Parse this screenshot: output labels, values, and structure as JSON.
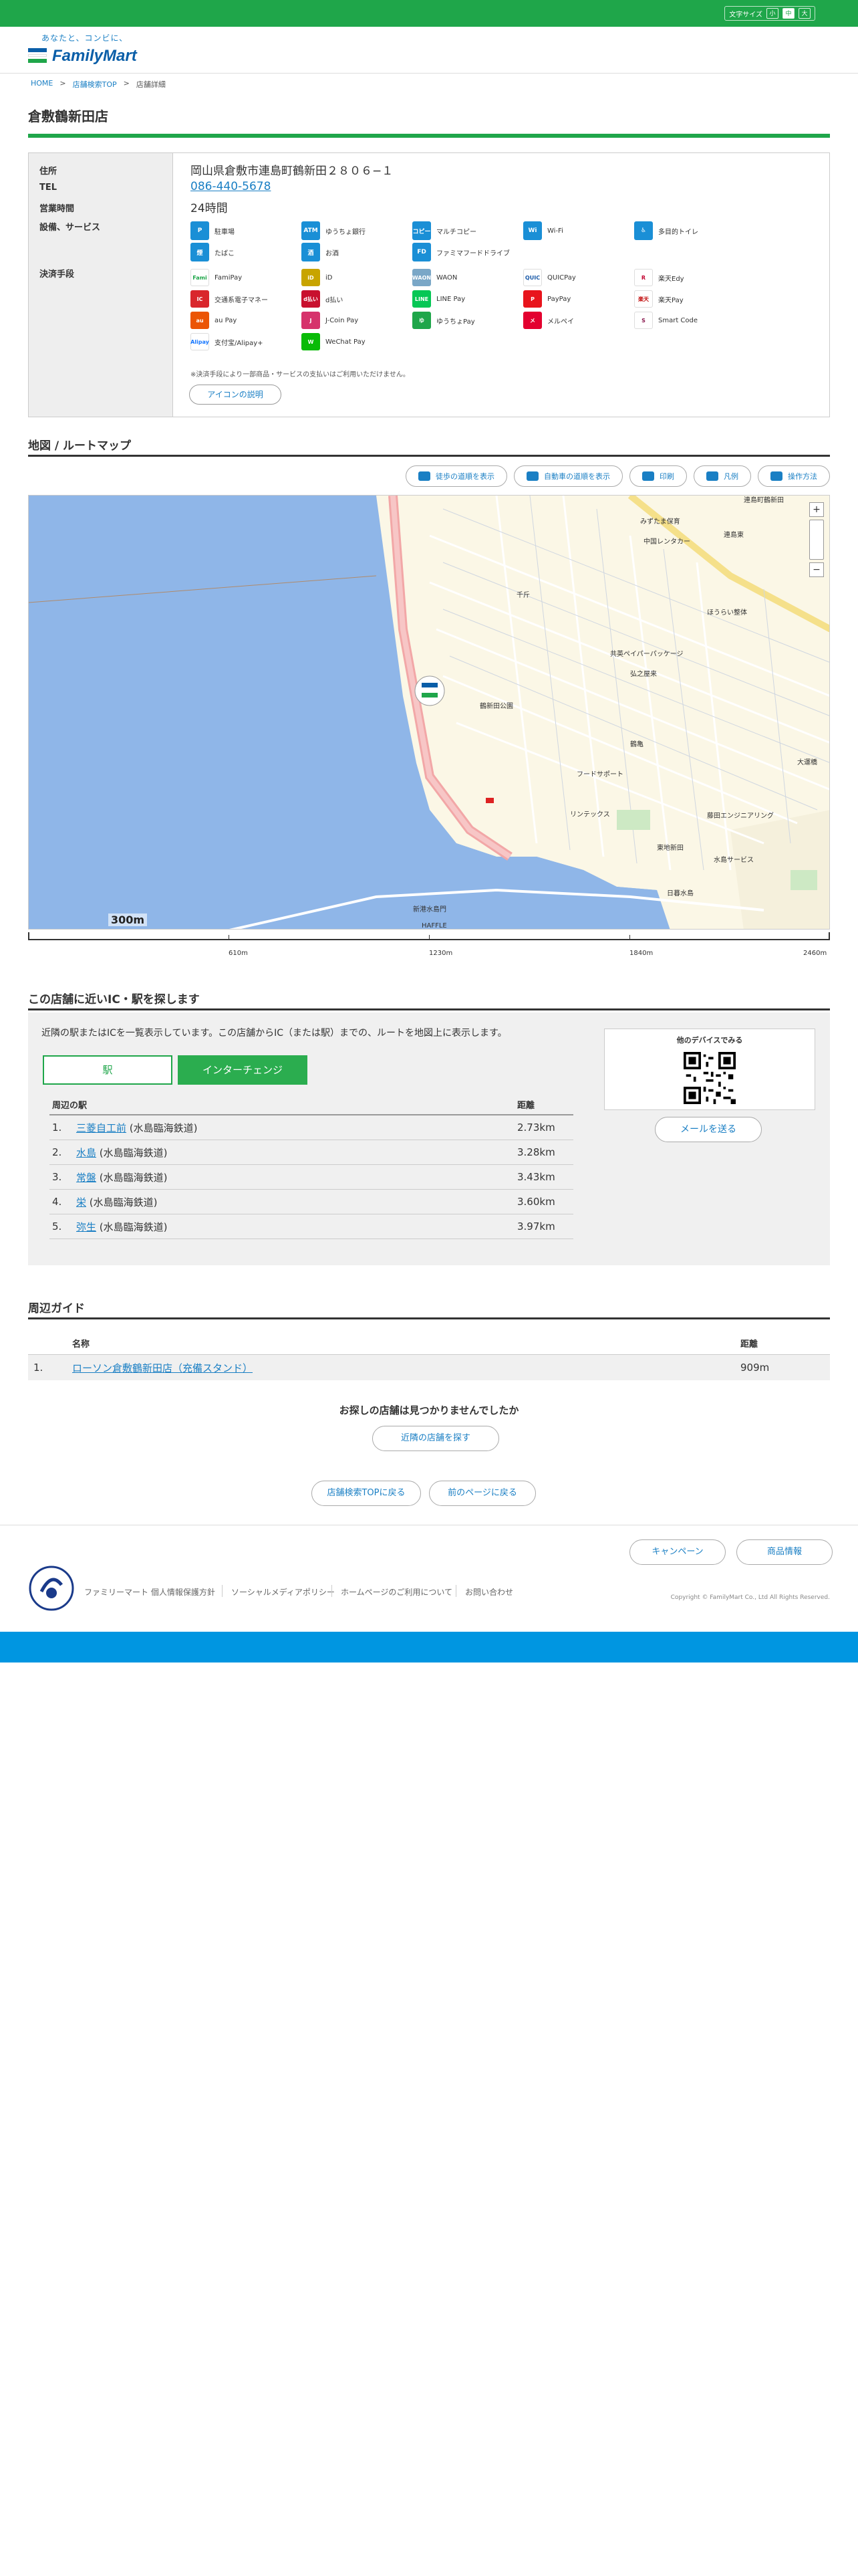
{
  "topbar": {
    "font_size_label": "文字サイズ",
    "sizes": [
      "小",
      "中",
      "大"
    ]
  },
  "header": {
    "tagline": "あなたと、コンビに、",
    "logo_text": "FamilyMart"
  },
  "breadcrumb": {
    "home": "HOME",
    "search_top": "店舗検索TOP",
    "current": "店舗詳細",
    "sep": ">"
  },
  "store": {
    "name": "倉敷鶴新田店",
    "labels": {
      "address": "住所",
      "tel": "TEL",
      "hours": "営業時間",
      "services": "設備、サービス",
      "payment": "決済手段"
    },
    "address": "岡山県倉敷市連島町鶴新田２８０６−１",
    "tel": "086-440-5678",
    "hours": "24時間",
    "services": [
      {
        "icon": "P",
        "label": "駐車場",
        "icon_name": "parking-icon"
      },
      {
        "icon": "ATM",
        "label": "ゆうちょ銀行",
        "icon_name": "atm-icon"
      },
      {
        "icon": "コピー",
        "label": "マルチコピー",
        "icon_name": "multi-copy-icon"
      },
      {
        "icon": "Wi",
        "label": "Wi-Fi",
        "icon_name": "wifi-icon"
      },
      {
        "icon": "♿",
        "label": "多目的トイレ",
        "icon_name": "accessible-toilet-icon"
      },
      {
        "icon": "煙",
        "label": "たばこ",
        "icon_name": "tobacco-icon"
      },
      {
        "icon": "酒",
        "label": "お酒",
        "icon_name": "alcohol-icon"
      },
      {
        "icon": "FD",
        "label": "ファミマフードドライブ",
        "icon_name": "food-drive-icon"
      }
    ],
    "payments": [
      {
        "icon": "Fami",
        "label": "FamiPay",
        "color": "#1fa64a",
        "bg": "#ffffff"
      },
      {
        "icon": "iD",
        "label": "iD",
        "color": "#ffffff",
        "bg": "#c8a400"
      },
      {
        "icon": "WAON",
        "label": "WAON",
        "color": "#ffffff",
        "bg": "#7aa7c7"
      },
      {
        "icon": "QUIC",
        "label": "QUICPay",
        "color": "#1a5aa8",
        "bg": "#ffffff"
      },
      {
        "icon": "R",
        "label": "楽天Edy",
        "color": "#c2002f",
        "bg": "#ffffff"
      },
      {
        "icon": "IC",
        "label": "交通系電子マネー",
        "color": "#ffffff",
        "bg": "#d9262c"
      },
      {
        "icon": "d払い",
        "label": "d払い",
        "color": "#ffffff",
        "bg": "#c8102e"
      },
      {
        "icon": "LINE",
        "label": "LINE Pay",
        "color": "#ffffff",
        "bg": "#06c755"
      },
      {
        "icon": "P",
        "label": "PayPay",
        "color": "#ffffff",
        "bg": "#e8141c"
      },
      {
        "icon": "楽天",
        "label": "楽天Pay",
        "color": "#bf0000",
        "bg": "#ffffff"
      },
      {
        "icon": "au",
        "label": "au Pay",
        "color": "#ffffff",
        "bg": "#eb5505"
      },
      {
        "icon": "J",
        "label": "J-Coin Pay",
        "color": "#ffffff",
        "bg": "#d6336c"
      },
      {
        "icon": "ゆ",
        "label": "ゆうちょPay",
        "color": "#ffffff",
        "bg": "#1fa64a"
      },
      {
        "icon": "メ",
        "label": "メルペイ",
        "color": "#ffffff",
        "bg": "#e3002f"
      },
      {
        "icon": "S",
        "label": "Smart Code",
        "color": "#8a1a4f",
        "bg": "#ffffff"
      },
      {
        "icon": "Alipay",
        "label": "支付宝/Alipay+",
        "color": "#1677ff",
        "bg": "#ffffff"
      },
      {
        "icon": "W",
        "label": "WeChat Pay",
        "color": "#ffffff",
        "bg": "#09bb07"
      }
    ],
    "note": "※決済手段により一部商品・サービスの支払いはご利用いただけません。",
    "icon_help": "アイコンの説明"
  },
  "map_section": {
    "title": "地図 / ルートマップ",
    "tools": [
      "徒歩の道順を表示",
      "自動車の道順を表示",
      "印刷",
      "凡例",
      "操作方法"
    ],
    "scale_label": "300m",
    "scale_ticks": [
      "610m",
      "1230m",
      "1840m",
      "2460m"
    ],
    "labels": {
      "l1": "連島町鶴新田",
      "l2": "中国レンタカー",
      "l3": "みずたま保育",
      "l4": "連島東",
      "l5": "ほうらい整体",
      "l6": "共英ペイパーパッケージ",
      "l7": "弘之屋来",
      "l8": "鶴新田公園",
      "l9": "フードサポート",
      "l10": "リンテックス",
      "l11": "藤田エンジニアリング",
      "l12": "東地新田",
      "l13": "水島サービス",
      "l14": "新港水島門",
      "l15": "日暮水島",
      "l16": "HAFFLE",
      "l17": "大運橋",
      "l18": "鶴亀",
      "l19": "千斤"
    }
  },
  "nearby": {
    "title": "この店舗に近いIC・駅を探します",
    "desc": "近隣の駅またはICを一覧表示しています。この店舗からIC（または駅）までの、ルートを地図上に表示します。",
    "tab_station": "駅",
    "tab_ic": "インターチェンジ",
    "head_name": "周辺の駅",
    "head_dist": "距離",
    "stations": [
      {
        "num": "1.",
        "name": "三菱自工前",
        "line": "(水島臨海鉄道)",
        "dist": "2.73km"
      },
      {
        "num": "2.",
        "name": "水島",
        "line": "(水島臨海鉄道)",
        "dist": "3.28km"
      },
      {
        "num": "3.",
        "name": "常盤",
        "line": "(水島臨海鉄道)",
        "dist": "3.43km"
      },
      {
        "num": "4.",
        "name": "栄",
        "line": "(水島臨海鉄道)",
        "dist": "3.60km"
      },
      {
        "num": "5.",
        "name": "弥生",
        "line": "(水島臨海鉄道)",
        "dist": "3.97km"
      }
    ],
    "qr_title": "他のデバイスでみる",
    "mail_btn": "メールを送る"
  },
  "guide": {
    "title": "周辺ガイド",
    "head_name": "名称",
    "head_dist": "距離",
    "rows": [
      {
        "num": "1.",
        "name": "ローソン倉敷鶴新田店（充備スタンド）",
        "dist": "909m"
      }
    ]
  },
  "search": {
    "not_found": "お探しの店舗は見つかりませんでしたか",
    "nearby_btn": "近隣の店舗を探す",
    "top_btn": "店舗検索TOPに戻る",
    "back_btn": "前のページに戻る"
  },
  "footer": {
    "campaign": "キャンペーン",
    "products": "商品情報",
    "links": [
      "ファミリーマート 個人情報保護方針",
      "ソーシャルメディアポリシー",
      "ホームページのご利用について",
      "お問い合わせ"
    ],
    "copyright": "Copyright © FamilyMart Co., Ltd All Rights Reserved."
  },
  "colors": {
    "brand_green": "#1fa64a",
    "brand_blue": "#0096e1",
    "link": "#1a7fc4"
  }
}
